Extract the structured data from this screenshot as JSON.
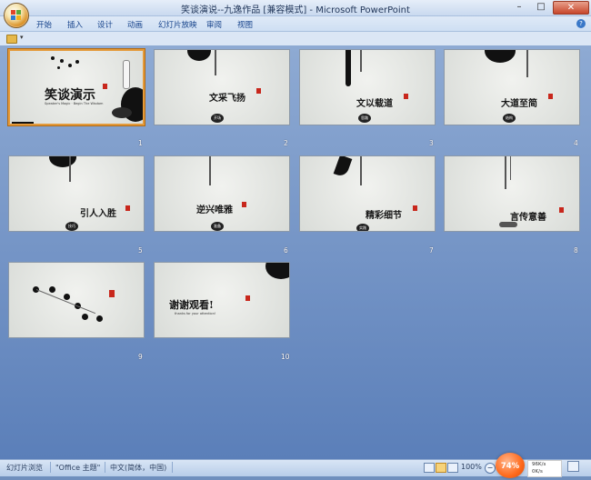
{
  "window": {
    "title": "笑谈演说--九逸作品 [兼容模式] - Microsoft PowerPoint",
    "controls": {
      "minimize": "–",
      "maximize": "□",
      "close": "✕"
    }
  },
  "ribbon": {
    "tabs": [
      "开始",
      "插入",
      "设计",
      "动画",
      "幻灯片放映",
      "审阅",
      "视图"
    ],
    "help_icon": "?"
  },
  "qat": {
    "dropdown": "▾"
  },
  "slides": [
    {
      "number": "1",
      "title": "笑谈演示",
      "subtitle": "Speaker's Magic · Begin The Wisdom",
      "selected": true
    },
    {
      "number": "2",
      "title": "文采飞扬",
      "subtitle": "",
      "badge": "开场"
    },
    {
      "number": "3",
      "title": "文以载道",
      "subtitle": "",
      "badge": "思路"
    },
    {
      "number": "4",
      "title": "大道至简",
      "subtitle": "",
      "badge": "结构"
    },
    {
      "number": "5",
      "title": "引人入胜",
      "subtitle": "",
      "badge": "技巧"
    },
    {
      "number": "6",
      "title": "逆兴唯雅",
      "subtitle": "",
      "badge": "准备"
    },
    {
      "number": "7",
      "title": "精彩细节",
      "subtitle": "",
      "badge": "实践"
    },
    {
      "number": "8",
      "title": "言传意善",
      "subtitle": "",
      "badge": ""
    },
    {
      "number": "9",
      "title": "",
      "subtitle": "",
      "badge": ""
    },
    {
      "number": "10",
      "title": "谢谢观看!",
      "subtitle": "thanks for your attention!",
      "badge": ""
    }
  ],
  "statusbar": {
    "view_name": "幻灯片浏览",
    "theme": "\"Office 主题\"",
    "language": "中文(简体，中国)",
    "zoom": "100%",
    "zoom_minus": "−",
    "zoom_badge": "74%",
    "net_up": "96K/s",
    "net_down": "0K/s"
  }
}
